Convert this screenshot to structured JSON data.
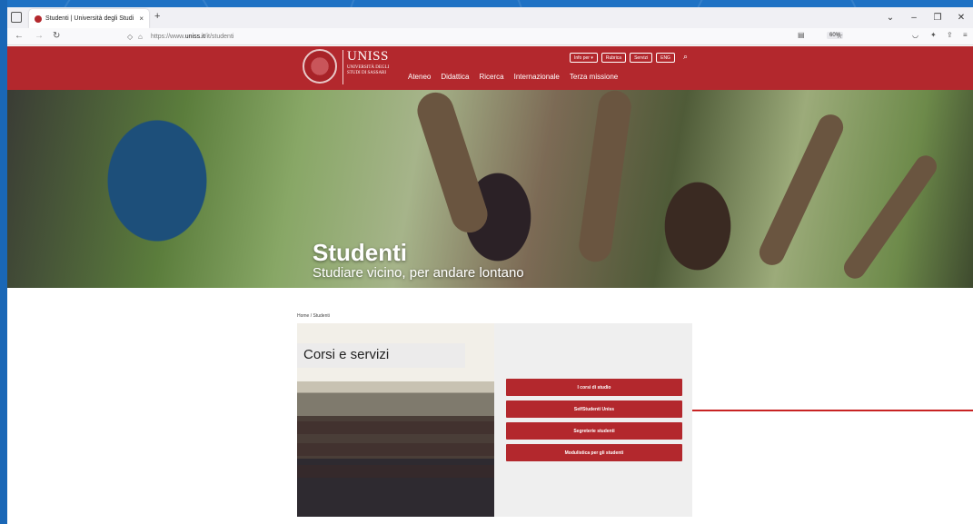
{
  "browser": {
    "tab_title": "Studenti | Università degli Studi",
    "tab_close": "×",
    "new_tab": "+",
    "url_prefix": "https://www.",
    "url_host": "uniss.it",
    "url_path": "/it/studenti",
    "zoom": "60%",
    "window_controls": {
      "chevron": "⌄",
      "minimize": "–",
      "restore": "❐",
      "close": "✕"
    }
  },
  "header": {
    "logo_name": "UNISS",
    "logo_sub": "UNIVERSITÀ DEGLI STUDI DI SASSARI",
    "buttons": [
      "Info per ▾",
      "Rubrica",
      "Servizi",
      "ENG"
    ],
    "nav": [
      "Ateneo",
      "Didattica",
      "Ricerca",
      "Internazionale",
      "Terza missione"
    ]
  },
  "hero": {
    "title": "Studenti",
    "subtitle": "Studiare vicino, per andare lontano"
  },
  "breadcrumb": "Home  /  Studenti",
  "card": {
    "label": "Corsi e servizi",
    "buttons": [
      "I corsi di studio",
      "SelfStudenti Uniss",
      "Segreterie studenti",
      "Modulistica per gli studenti"
    ]
  },
  "colors": {
    "brand_red": "#b3282d",
    "desktop_blue": "#1f72c4"
  }
}
